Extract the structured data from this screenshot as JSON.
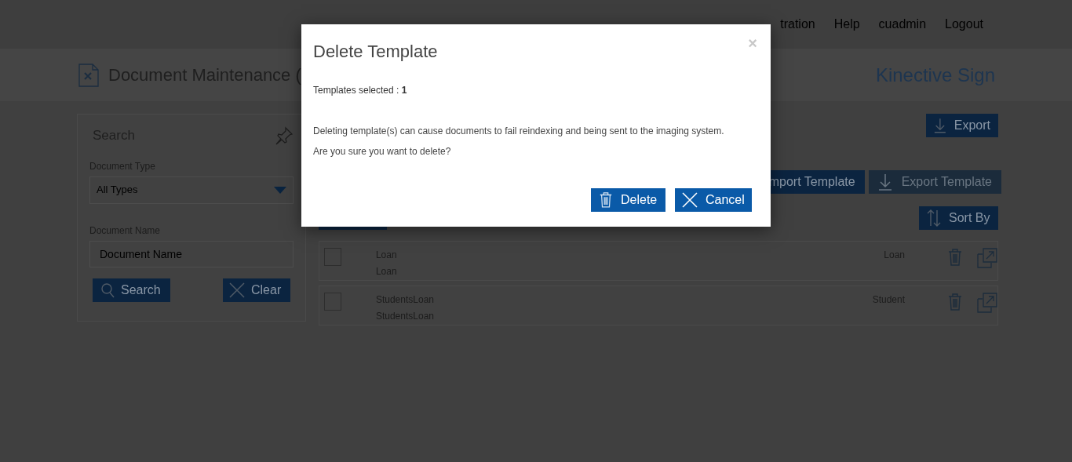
{
  "nav": [
    {
      "label": "tration"
    },
    {
      "label": "Help"
    },
    {
      "label": "cuadmin"
    },
    {
      "label": "Logout"
    }
  ],
  "page_title": "Document Maintenance (",
  "brand": "Kinective Sign",
  "search_panel": {
    "title": "Search",
    "document_type_label": "Document Type",
    "document_type_value": "All Types",
    "document_name_label": "Document Name",
    "document_name_placeholder": "Document Name",
    "search_button": "Search",
    "clear_button": "Clear"
  },
  "export_button": "Export",
  "template_buttons": [
    {
      "label": "mport Template",
      "disabled": false
    },
    {
      "label": "Export Template",
      "disabled": true
    }
  ],
  "sort_button": "Sort By",
  "rows": [
    {
      "checked": false,
      "name": "Loan",
      "description": "Loan",
      "type": "Loan"
    },
    {
      "checked": false,
      "name": "StudentsLoan",
      "description": "StudentsLoan",
      "type": "Student"
    }
  ],
  "dialog": {
    "title": "Delete Template",
    "close": "×",
    "selected_label": "Templates selected : **1**",
    "message": "Deleting template(s) can cause documents to fail reindexing and being sent to the imaging system.",
    "question": "Are you sure you want to delete?",
    "delete_button": "Delete",
    "cancel_button": "Cancel"
  }
}
